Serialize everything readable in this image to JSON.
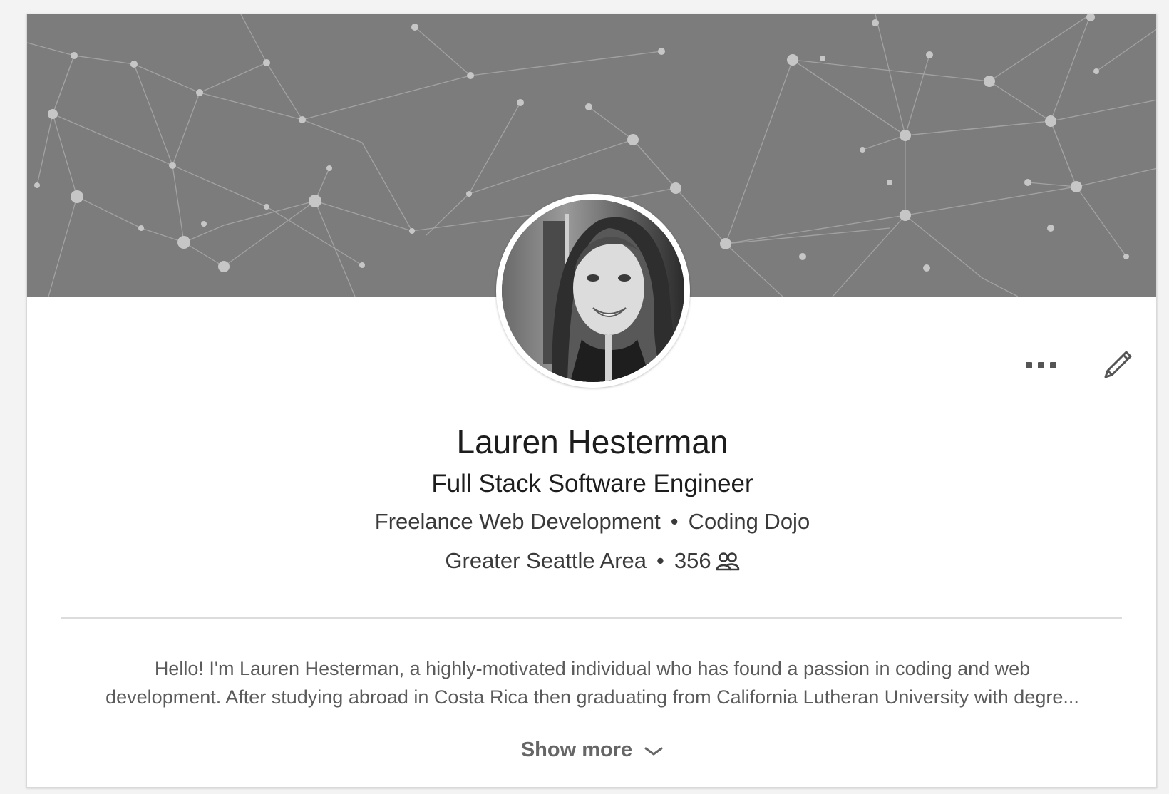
{
  "profile": {
    "name": "Lauren Hesterman",
    "headline": "Full Stack Software Engineer",
    "current_company": "Freelance Web Development",
    "education": "Coding Dojo",
    "location": "Greater Seattle Area",
    "connections": "356",
    "separator": "•"
  },
  "summary": {
    "line1": "Hello! I'm Lauren Hesterman, a highly-motivated individual who has found a passion in coding and web",
    "line2": "development. After studying abroad in Costa Rica then graduating from California Lutheran University with degre..."
  },
  "actions": {
    "show_more_label": "Show more",
    "more_icon": "more-horizontal-icon",
    "edit_icon": "pencil-icon"
  },
  "colors": {
    "banner": "#7c7c7c",
    "card": "#ffffff",
    "page_bg": "#f3f3f3"
  }
}
